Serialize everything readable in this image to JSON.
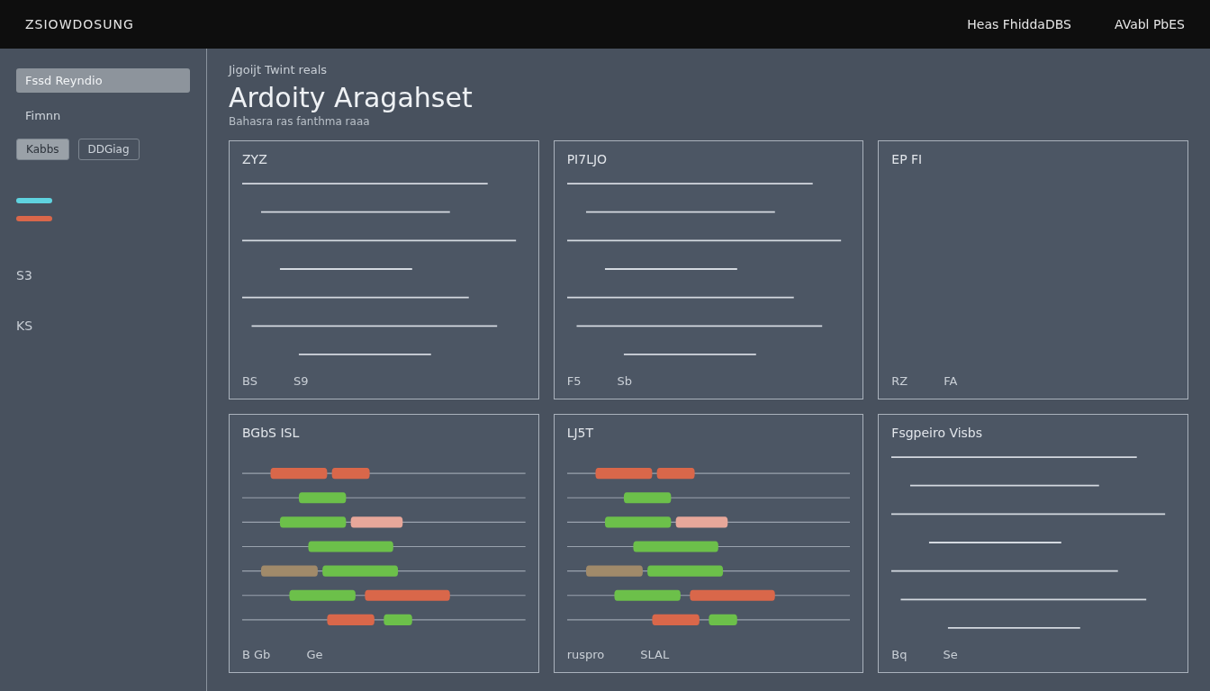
{
  "bezel": {
    "brand": "ZSIOWDOSUNG",
    "nav": [
      {
        "label": "Heas FhiddaDBS"
      },
      {
        "label": "AVabl PbES"
      }
    ]
  },
  "sidebar": {
    "filters": [
      {
        "label": "Fssd Reyndio",
        "selected": true
      },
      {
        "label": "Fimnn",
        "selected": false
      }
    ],
    "chips": [
      {
        "label": "Kabbs",
        "selected": true
      },
      {
        "label": "DDGiag",
        "selected": false
      }
    ],
    "labels": [
      "S3",
      "KS"
    ]
  },
  "header": {
    "caption": "Jigoijt Twint reals",
    "title": "Ardoity Aragahset",
    "subtitle": "Bahasra ras fanthma raaa"
  },
  "panels": [
    {
      "kind": "lines",
      "title": "ZYZ",
      "labels": [
        "BS",
        "S9"
      ]
    },
    {
      "kind": "lines",
      "title": "PI7LJO",
      "labels": [
        "F5",
        "Sb"
      ]
    },
    {
      "kind": "text",
      "title": "EP FI",
      "labels": [
        "RZ",
        "FA"
      ]
    },
    {
      "kind": "gantt",
      "title": "BGbS ISL",
      "labels": [
        "B Gb",
        "Ge"
      ]
    },
    {
      "kind": "gantt",
      "title": "LJ5T",
      "labels": [
        "ruspro",
        "SLAL"
      ]
    },
    {
      "kind": "lines",
      "title": "Fsgpeiro Visbs",
      "labels": [
        "Bq",
        "Se"
      ]
    }
  ]
}
